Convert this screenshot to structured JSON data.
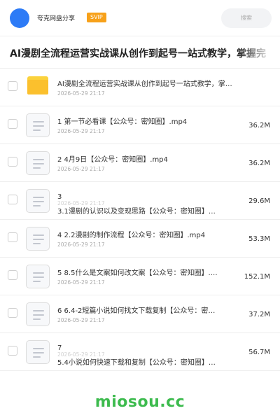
{
  "header": {
    "share_name": "夸克网盘分享",
    "svip_badge": "SVIP",
    "search_placeholder": "搜索"
  },
  "page_title": "AI漫剧全流程运营实战课从创作到起号一站式教学，掌握完",
  "files": [
    {
      "type": "folder",
      "name": "AI漫剧全流程运营实战课从创作到起号一站式教学，掌…",
      "date": "2026-05-29 21:17",
      "size": ""
    },
    {
      "type": "file",
      "name": "1 第一节必看课【公众号：密知圈】.mp4",
      "date": "2026-05-29 21:17",
      "size": "36.2M"
    },
    {
      "type": "file",
      "name": "2 4月9日【公众号：密知圈】.mp4",
      "date": "2026-05-29 21:17",
      "size": "36.2M"
    },
    {
      "type": "file",
      "name": "3",
      "name2": "3.1漫剧的认识以及变现思路【公众号：密知圈】…",
      "date": "2026-05-29 21:17",
      "size": "29.6M"
    },
    {
      "type": "file",
      "name": "4 2.2漫剧的制作流程【公众号：密知圈】.mp4",
      "date": "2026-05-29 21:17",
      "size": "53.3M"
    },
    {
      "type": "file",
      "name": "5 8.5什么是文案如何改文案【公众号：密知圈】.…",
      "date": "2026-05-29 21:17",
      "size": "152.1M"
    },
    {
      "type": "file",
      "name": "6 6.4-2短篇小说如何找文下载复制【公众号：密…",
      "date": "2026-05-29 21:17",
      "size": "37.2M"
    },
    {
      "type": "file",
      "name": "7",
      "name2": "5.4小说如何快速下载和复制【公众号：密知圈】…",
      "date": "2026-05-29 21:17",
      "size": "56.7M"
    }
  ],
  "watermark": "miosou.cc",
  "colors": {
    "avatar": "#2d7bf6",
    "svip": "#f7a11a",
    "folder": "#fbc02d",
    "watermark": "#3dbb4e"
  },
  "icons": {
    "folder": "folder-icon",
    "file": "file-icon"
  }
}
